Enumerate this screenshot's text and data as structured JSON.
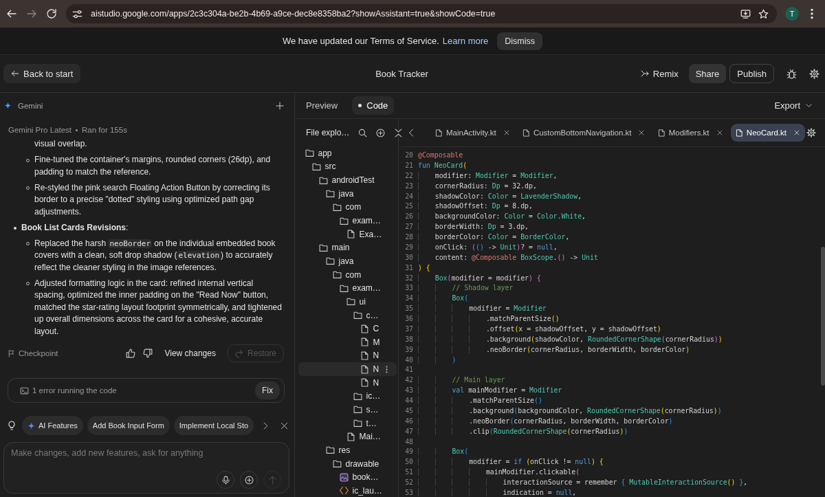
{
  "browser": {
    "url": "aistudio.google.com/apps/2c3c304a-be2b-4b69-a9ce-dec8e8358ba2?showAssistant=true&showCode=true",
    "avatar_initial": "T"
  },
  "banner": {
    "message": "We have updated our Terms of Service.",
    "link": "Learn more",
    "dismiss": "Dismiss"
  },
  "header": {
    "back": "Back to start",
    "title": "Book Tracker",
    "actions": [
      {
        "label": "Remix",
        "kind": "text"
      },
      {
        "label": "Share",
        "kind": "filled"
      },
      {
        "label": "Publish",
        "kind": "outlined"
      }
    ]
  },
  "assistant": {
    "title": "Gemini",
    "model": "Gemini Pro Latest",
    "run_time": "Ran for 155s",
    "message": [
      {
        "kind": "continuation",
        "parts": [
          {
            "text": "visual overlap.",
            "kind": "plain"
          }
        ]
      },
      {
        "kind": "sub_bullet",
        "parts": [
          {
            "text": "Fine-tuned the container's margins, rounded corners (26dp), and padding to match the reference.",
            "kind": "plain"
          }
        ]
      },
      {
        "kind": "sub_bullet",
        "parts": [
          {
            "text": "Re-styled the pink search Floating Action Button by correcting its border to a precise \"dotted\" styling using optimized path gap adjustments.",
            "kind": "plain"
          }
        ]
      },
      {
        "kind": "bullet",
        "parts": [
          {
            "text": "**Book List Cards Revisions**:",
            "kind": "plain"
          }
        ]
      },
      {
        "kind": "sub_bullet",
        "parts": [
          {
            "text": "Replaced the harsh ",
            "kind": "plain"
          },
          {
            "text": "neoBorder",
            "kind": "code"
          },
          {
            "text": " on the individual embedded book covers with a clean, soft drop shadow (",
            "kind": "plain"
          },
          {
            "text": "elevation",
            "kind": "code"
          },
          {
            "text": ") to accurately reflect the cleaner styling in the image references.",
            "kind": "plain"
          }
        ]
      },
      {
        "kind": "sub_bullet",
        "parts": [
          {
            "text": "Adjusted formatting logic in the card: refined internal vertical spacing, optimized the inner padding on the \"Read Now\" button, matched the star-rating layout footprint symmetrically, and tightened up overall dimensions across the card for a cohesive, accurate layout.",
            "kind": "plain"
          }
        ]
      }
    ],
    "checkpoint": {
      "label": "Checkpoint",
      "view_changes": "View changes",
      "restore": {
        "label": "Restore",
        "disabled": true
      }
    },
    "error": {
      "message": "1 error running the code",
      "action": "Fix"
    },
    "suggestions": [
      {
        "label": "AI Features",
        "kind": "sparkle"
      },
      {
        "label": "Add Book Input Form",
        "kind": "plain"
      },
      {
        "label": "Implement Local Sto",
        "kind": "plain"
      }
    ],
    "composer": {
      "placeholder": "Make changes, add new features, ask for anything",
      "send": {
        "disabled": true
      }
    }
  },
  "view_tabs": [
    {
      "label": "Preview",
      "selected": false
    },
    {
      "label": "Code",
      "selected": true
    }
  ],
  "export": "Export",
  "file_explorer": {
    "title": "File explo…",
    "tree": [
      {
        "label": "app",
        "kind": "folder",
        "selected": false,
        "children": [
          {
            "label": "src",
            "kind": "folder",
            "selected": false,
            "children": [
              {
                "label": "androidTest",
                "kind": "folder",
                "selected": false,
                "children": [
                  {
                    "label": "java",
                    "kind": "folder",
                    "selected": false,
                    "children": [
                      {
                        "label": "com",
                        "kind": "folder",
                        "selected": false,
                        "children": [
                          {
                            "label": "exam…",
                            "kind": "folder",
                            "selected": false,
                            "children": [
                              {
                                "label": "Exa…",
                                "kind": "file",
                                "selected": false
                              }
                            ]
                          }
                        ]
                      }
                    ]
                  }
                ]
              },
              {
                "label": "main",
                "kind": "folder",
                "selected": false,
                "children": [
                  {
                    "label": "java",
                    "kind": "folder",
                    "selected": false,
                    "children": [
                      {
                        "label": "com",
                        "kind": "folder",
                        "selected": false,
                        "children": [
                          {
                            "label": "exam…",
                            "kind": "folder",
                            "selected": false,
                            "children": [
                              {
                                "label": "ui",
                                "kind": "folder",
                                "selected": false,
                                "children": [
                                  {
                                    "label": "c…",
                                    "kind": "folder",
                                    "selected": false,
                                    "children": [
                                      {
                                        "label": "C",
                                        "kind": "file",
                                        "selected": false
                                      },
                                      {
                                        "label": "M",
                                        "kind": "file",
                                        "selected": false
                                      },
                                      {
                                        "label": "N",
                                        "kind": "file",
                                        "selected": false
                                      },
                                      {
                                        "label": "N",
                                        "kind": "file",
                                        "selected": true
                                      },
                                      {
                                        "label": "N",
                                        "kind": "file",
                                        "selected": false
                                      }
                                    ]
                                  },
                                  {
                                    "label": "ic…",
                                    "kind": "folder",
                                    "selected": false
                                  },
                                  {
                                    "label": "s…",
                                    "kind": "folder",
                                    "selected": false
                                  },
                                  {
                                    "label": "t…",
                                    "kind": "folder",
                                    "selected": false
                                  }
                                ]
                              },
                              {
                                "label": "Mai…",
                                "kind": "file",
                                "selected": false
                              }
                            ]
                          }
                        ]
                      }
                    ]
                  },
                  {
                    "label": "res",
                    "kind": "folder",
                    "selected": false,
                    "children": [
                      {
                        "label": "drawable",
                        "kind": "folder",
                        "selected": false,
                        "children": [
                          {
                            "label": "book…",
                            "kind": "image",
                            "selected": false
                          },
                          {
                            "label": "ic_lau…",
                            "kind": "code",
                            "selected": false
                          }
                        ]
                      }
                    ]
                  }
                ]
              }
            ]
          }
        ]
      }
    ]
  },
  "editor": {
    "tabs": [
      {
        "label": "MainActivity.kt",
        "selected": false
      },
      {
        "label": "CustomBottomNavigation.kt",
        "selected": false
      },
      {
        "label": "Modifiers.kt",
        "selected": false
      },
      {
        "label": "NeoCard.kt",
        "selected": true
      }
    ],
    "lines": [
      {
        "number": "20",
        "tokens": [
          {
            "text": "@Composable",
            "kind": "annotation"
          }
        ]
      },
      {
        "number": "21",
        "tokens": [
          {
            "text": "fun",
            "kind": "keyword"
          },
          {
            "text": " NeoCard",
            "kind": "type"
          },
          {
            "text": "(",
            "kind": "bracket_1"
          }
        ]
      },
      {
        "number": "22",
        "tokens": [
          "    modifier: ",
          {
            "text": "Modifier",
            "kind": "type"
          },
          " = ",
          {
            "text": "Modifier",
            "kind": "type"
          },
          ","
        ]
      },
      {
        "number": "23",
        "tokens": [
          "    cornerRadius: ",
          {
            "text": "Dp",
            "kind": "type"
          },
          " = 32.dp,"
        ]
      },
      {
        "number": "24",
        "tokens": [
          "    shadowColor: ",
          {
            "text": "Color",
            "kind": "type"
          },
          " = ",
          {
            "text": "LavenderShadow",
            "kind": "type"
          },
          ","
        ]
      },
      {
        "number": "25",
        "tokens": [
          "    shadowOffset: ",
          {
            "text": "Dp",
            "kind": "type"
          },
          " = 8.dp,"
        ]
      },
      {
        "number": "26",
        "tokens": [
          "    backgroundColor: ",
          {
            "text": "Color",
            "kind": "type"
          },
          " = ",
          {
            "text": "Color.White",
            "kind": "type"
          },
          ","
        ]
      },
      {
        "number": "27",
        "tokens": [
          "    borderWidth: ",
          {
            "text": "Dp",
            "kind": "type"
          },
          " = 3.dp,"
        ]
      },
      {
        "number": "28",
        "tokens": [
          "    borderColor: ",
          {
            "text": "Color",
            "kind": "type"
          },
          " = ",
          {
            "text": "BorderColor",
            "kind": "type"
          },
          ","
        ]
      },
      {
        "number": "29",
        "tokens": [
          "    onClick: ",
          {
            "text": "(",
            "kind": "bracket_2"
          },
          {
            "text": "()",
            "kind": "bracket_3"
          },
          " -> ",
          {
            "text": "Unit",
            "kind": "type"
          },
          {
            "text": ")",
            "kind": "bracket_2"
          },
          "? = ",
          {
            "text": "null",
            "kind": "keyword"
          },
          ","
        ]
      },
      {
        "number": "30",
        "tokens": [
          "    content: ",
          {
            "text": "@Composable",
            "kind": "annotation"
          },
          {
            "text": " BoxScope",
            "kind": "type"
          },
          ".",
          {
            "text": "()",
            "kind": "bracket_2"
          },
          " -> ",
          {
            "text": "Unit",
            "kind": "type"
          }
        ]
      },
      {
        "number": "31",
        "tokens": [
          {
            "text": ")",
            "kind": "bracket_1"
          },
          {
            "text": " {",
            "kind": "bracket_1"
          }
        ]
      },
      {
        "number": "32",
        "tokens": [
          {
            "text": "    Box",
            "kind": "type"
          },
          {
            "text": "(",
            "kind": "bracket_2"
          },
          "modifier = modifier",
          {
            "text": ")",
            "kind": "bracket_2"
          },
          {
            "text": " {",
            "kind": "bracket_2"
          }
        ]
      },
      {
        "number": "33",
        "tokens": [
          {
            "text": "        // Shadow layer",
            "kind": "comment"
          }
        ]
      },
      {
        "number": "34",
        "tokens": [
          {
            "text": "        Box",
            "kind": "type"
          },
          {
            "text": "(",
            "kind": "bracket_3"
          }
        ]
      },
      {
        "number": "35",
        "tokens": [
          "            modifier = ",
          {
            "text": "Modifier",
            "kind": "type"
          }
        ]
      },
      {
        "number": "36",
        "tokens": [
          "                .matchParentSize",
          {
            "text": "()",
            "kind": "bracket_1"
          }
        ]
      },
      {
        "number": "37",
        "tokens": [
          "                .offset",
          {
            "text": "(",
            "kind": "bracket_1"
          },
          "x = shadowOffset, y = shadowOffset",
          {
            "text": ")",
            "kind": "bracket_1"
          }
        ]
      },
      {
        "number": "38",
        "tokens": [
          "                .background",
          {
            "text": "(",
            "kind": "bracket_1"
          },
          "shadowColor, ",
          {
            "text": "RoundedCornerShape",
            "kind": "type"
          },
          {
            "text": "(",
            "kind": "bracket_2"
          },
          "cornerRadius",
          {
            "text": ")",
            "kind": "bracket_2"
          },
          {
            "text": ")",
            "kind": "bracket_1"
          }
        ]
      },
      {
        "number": "39",
        "tokens": [
          "                .neoBorder",
          {
            "text": "(",
            "kind": "bracket_1"
          },
          "cornerRadius, borderWidth, borderColor",
          {
            "text": ")",
            "kind": "bracket_1"
          }
        ]
      },
      {
        "number": "40",
        "tokens": [
          {
            "text": "        )",
            "kind": "bracket_3"
          }
        ]
      },
      {
        "number": "41"
      },
      {
        "number": "42",
        "tokens": [
          {
            "text": "        // Main layer",
            "kind": "comment"
          }
        ]
      },
      {
        "number": "43",
        "tokens": [
          {
            "text": "        val",
            "kind": "keyword"
          },
          " mainModifier = ",
          {
            "text": "Modifier",
            "kind": "type"
          }
        ]
      },
      {
        "number": "44",
        "tokens": [
          "            .matchParentSize",
          {
            "text": "()",
            "kind": "bracket_3"
          }
        ]
      },
      {
        "number": "45",
        "tokens": [
          "            .background",
          {
            "text": "(",
            "kind": "bracket_3"
          },
          "backgroundColor, ",
          {
            "text": "RoundedCornerShape",
            "kind": "type"
          },
          {
            "text": "(",
            "kind": "bracket_1"
          },
          "cornerRadius",
          {
            "text": ")",
            "kind": "bracket_1"
          },
          {
            "text": ")",
            "kind": "bracket_3"
          }
        ]
      },
      {
        "number": "46",
        "tokens": [
          "            .neoBorder",
          {
            "text": "(",
            "kind": "bracket_3"
          },
          "cornerRadius, borderWidth, borderColor",
          {
            "text": ")",
            "kind": "bracket_3"
          }
        ]
      },
      {
        "number": "47",
        "tokens": [
          "            .clip",
          {
            "text": "(",
            "kind": "bracket_3"
          },
          {
            "text": "RoundedCornerShape",
            "kind": "type"
          },
          {
            "text": "(",
            "kind": "bracket_1"
          },
          "cornerRadius",
          {
            "text": ")",
            "kind": "bracket_1"
          },
          {
            "text": ")",
            "kind": "bracket_3"
          }
        ]
      },
      {
        "number": "48"
      },
      {
        "number": "49",
        "tokens": [
          {
            "text": "        Box",
            "kind": "type"
          },
          {
            "text": "(",
            "kind": "bracket_3"
          }
        ]
      },
      {
        "number": "50",
        "tokens": [
          "            modifier = ",
          {
            "text": "if",
            "kind": "keyword"
          },
          {
            "text": " (",
            "kind": "bracket_1"
          },
          "onClick != ",
          {
            "text": "null",
            "kind": "keyword"
          },
          {
            "text": ")",
            "kind": "bracket_1"
          },
          {
            "text": " {",
            "kind": "bracket_1"
          }
        ]
      },
      {
        "number": "51",
        "tokens": [
          "                mainModifier.clickable",
          {
            "text": "(",
            "kind": "bracket_2"
          }
        ]
      },
      {
        "number": "52",
        "tokens": [
          "                    interactionSource = remember ",
          {
            "text": "{",
            "kind": "bracket_3"
          },
          {
            "text": " MutableInteractionSource",
            "kind": "type"
          },
          {
            "text": "()",
            "kind": "bracket_1"
          },
          {
            "text": " }",
            "kind": "bracket_3"
          },
          ","
        ]
      },
      {
        "number": "53",
        "tokens": [
          "                    indication = ",
          {
            "text": "null",
            "kind": "keyword"
          },
          ","
        ]
      }
    ]
  }
}
